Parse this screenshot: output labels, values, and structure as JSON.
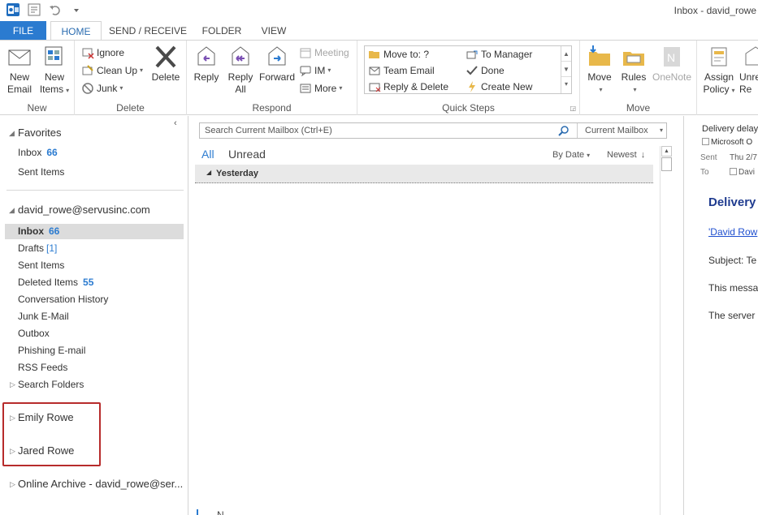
{
  "window": {
    "title": "Inbox - david_rowe"
  },
  "tabs": {
    "file": "FILE",
    "home": "HOME",
    "send_receive": "SEND / RECEIVE",
    "folder": "FOLDER",
    "view": "VIEW"
  },
  "ribbon": {
    "new": {
      "new_email_1": "New",
      "new_email_2": "Email",
      "new_items_1": "New",
      "new_items_2": "Items",
      "group": "New"
    },
    "delete": {
      "ignore": "Ignore",
      "clean_up": "Clean Up",
      "junk": "Junk",
      "delete": "Delete",
      "group": "Delete"
    },
    "respond": {
      "reply": "Reply",
      "reply_all_1": "Reply",
      "reply_all_2": "All",
      "forward": "Forward",
      "meeting": "Meeting",
      "im": "IM",
      "more": "More",
      "group": "Respond"
    },
    "quick_steps": {
      "move_to": "Move to: ?",
      "team_email": "Team Email",
      "reply_delete": "Reply & Delete",
      "to_manager": "To Manager",
      "done": "Done",
      "create_new": "Create New",
      "group": "Quick Steps"
    },
    "move": {
      "move": "Move",
      "rules": "Rules",
      "onenote": "OneNote",
      "group": "Move"
    },
    "tags": {
      "assign_policy_1": "Assign",
      "assign_policy_2": "Policy",
      "unread_1": "Unre",
      "unread_2": "Re"
    }
  },
  "nav": {
    "favorites": "Favorites",
    "fav_inbox": "Inbox",
    "fav_inbox_count": "66",
    "fav_sent": "Sent Items",
    "account": "david_rowe@servusinc.com",
    "inbox": "Inbox",
    "inbox_count": "66",
    "drafts": "Drafts",
    "drafts_count": "[1]",
    "sent": "Sent Items",
    "deleted": "Deleted Items",
    "deleted_count": "55",
    "conversation_history": "Conversation History",
    "junk": "Junk E-Mail",
    "outbox": "Outbox",
    "phishing": "Phishing E-mail",
    "rss": "RSS Feeds",
    "search_folders": "Search Folders",
    "emily": "Emily Rowe",
    "jared": "Jared Rowe",
    "archive": "Online Archive - david_rowe@ser..."
  },
  "list": {
    "search_placeholder": "Search Current Mailbox (Ctrl+E)",
    "scope": "Current Mailbox",
    "filter_all": "All",
    "filter_unread": "Unread",
    "sort_by": "By Date",
    "sort_order": "Newest",
    "group_yesterday": "Yesterday",
    "bottom_text": "N"
  },
  "reading": {
    "subject": "Delivery delay",
    "from": "Microsoft O",
    "sent_label": "Sent",
    "sent_value": "Thu 2/7",
    "to_label": "To",
    "to_value": "Davi",
    "heading": "Delivery",
    "link": "'David Row",
    "subject_line": "Subject: Te",
    "body1": "This messa",
    "body2": "The server"
  },
  "colors": {
    "accent": "#2b7bd0",
    "highlight_box": "#b72b2b",
    "selected_bg": "#dcdcdc"
  }
}
